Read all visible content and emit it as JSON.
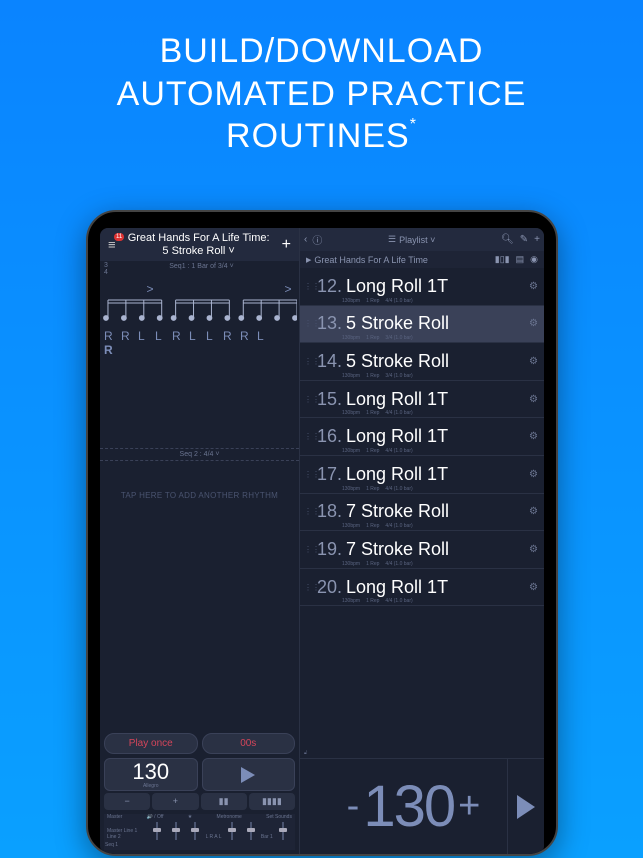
{
  "promo": {
    "line1": "BUILD/DOWNLOAD",
    "line2": "AUTOMATED PRACTICE",
    "line3": "ROUTINES",
    "asterisk": "*"
  },
  "left": {
    "badge": "11",
    "title_line1": "Great Hands For A Life Time:",
    "title_line2": "5 Stroke Roll ˅",
    "timesig": "3\n4",
    "seq1": "Seq1 : 1 Bar of 3/4 ˅",
    "accent": ">",
    "sticking": [
      "R",
      "R",
      "L",
      "L",
      "R",
      "L",
      "L",
      "R",
      "R",
      "L"
    ],
    "sticking_extra": "R",
    "seq2": "Seq 2 : 4/4 ˅",
    "add_hint": "TAP HERE TO ADD ANOTHER RHYTHM",
    "play_once": "Play once",
    "timer": "00s",
    "tempo": "130",
    "tempo_label": "Allegro",
    "minus": "−",
    "plus": "+",
    "tap": "▮▮",
    "bars": "▮▮▮▮",
    "mixer": {
      "master": "Master",
      "master_row": "Master  Line 1  Line 2",
      "fx": "🔊 / Off",
      "seq1": "Seq 1",
      "letters": "L    R    A    L",
      "bar": "Bar   1",
      "metronome": "Metronome",
      "set_sounds": "Set Sounds"
    }
  },
  "right": {
    "playlist_btn": "Playlist ˅",
    "subtitle": "Great Hands For A Life Time",
    "items": [
      {
        "num": "12.",
        "name": "Long Roll 1T",
        "bpm": "130bpm",
        "rep": "1 Rep",
        "ts": "4/4 (1.0 bar)"
      },
      {
        "num": "13.",
        "name": "5 Stroke Roll",
        "bpm": "130bpm",
        "rep": "1 Rep",
        "ts": "3/4 (1.0 bar)",
        "selected": true
      },
      {
        "num": "14.",
        "name": "5 Stroke Roll",
        "bpm": "130bpm",
        "rep": "1 Rep",
        "ts": "3/4 (1.0 bar)"
      },
      {
        "num": "15.",
        "name": "Long Roll 1T",
        "bpm": "130bpm",
        "rep": "1 Rep",
        "ts": "4/4 (1.0 bar)"
      },
      {
        "num": "16.",
        "name": "Long Roll 1T",
        "bpm": "130bpm",
        "rep": "1 Rep",
        "ts": "4/4 (1.0 bar)"
      },
      {
        "num": "17.",
        "name": "Long Roll 1T",
        "bpm": "130bpm",
        "rep": "1 Rep",
        "ts": "4/4 (1.0 bar)"
      },
      {
        "num": "18.",
        "name": "7 Stroke Roll",
        "bpm": "130bpm",
        "rep": "1 Rep",
        "ts": "4/4 (1.0 bar)"
      },
      {
        "num": "19.",
        "name": "7 Stroke Roll",
        "bpm": "130bpm",
        "rep": "1 Rep",
        "ts": "4/4 (1.0 bar)"
      },
      {
        "num": "20.",
        "name": "Long Roll 1T",
        "bpm": "130bpm",
        "rep": "1 Rep",
        "ts": "4/4 (1.0 bar)"
      }
    ],
    "bpm_minus": "-",
    "bpm_value": "130",
    "bpm_plus": "+"
  }
}
